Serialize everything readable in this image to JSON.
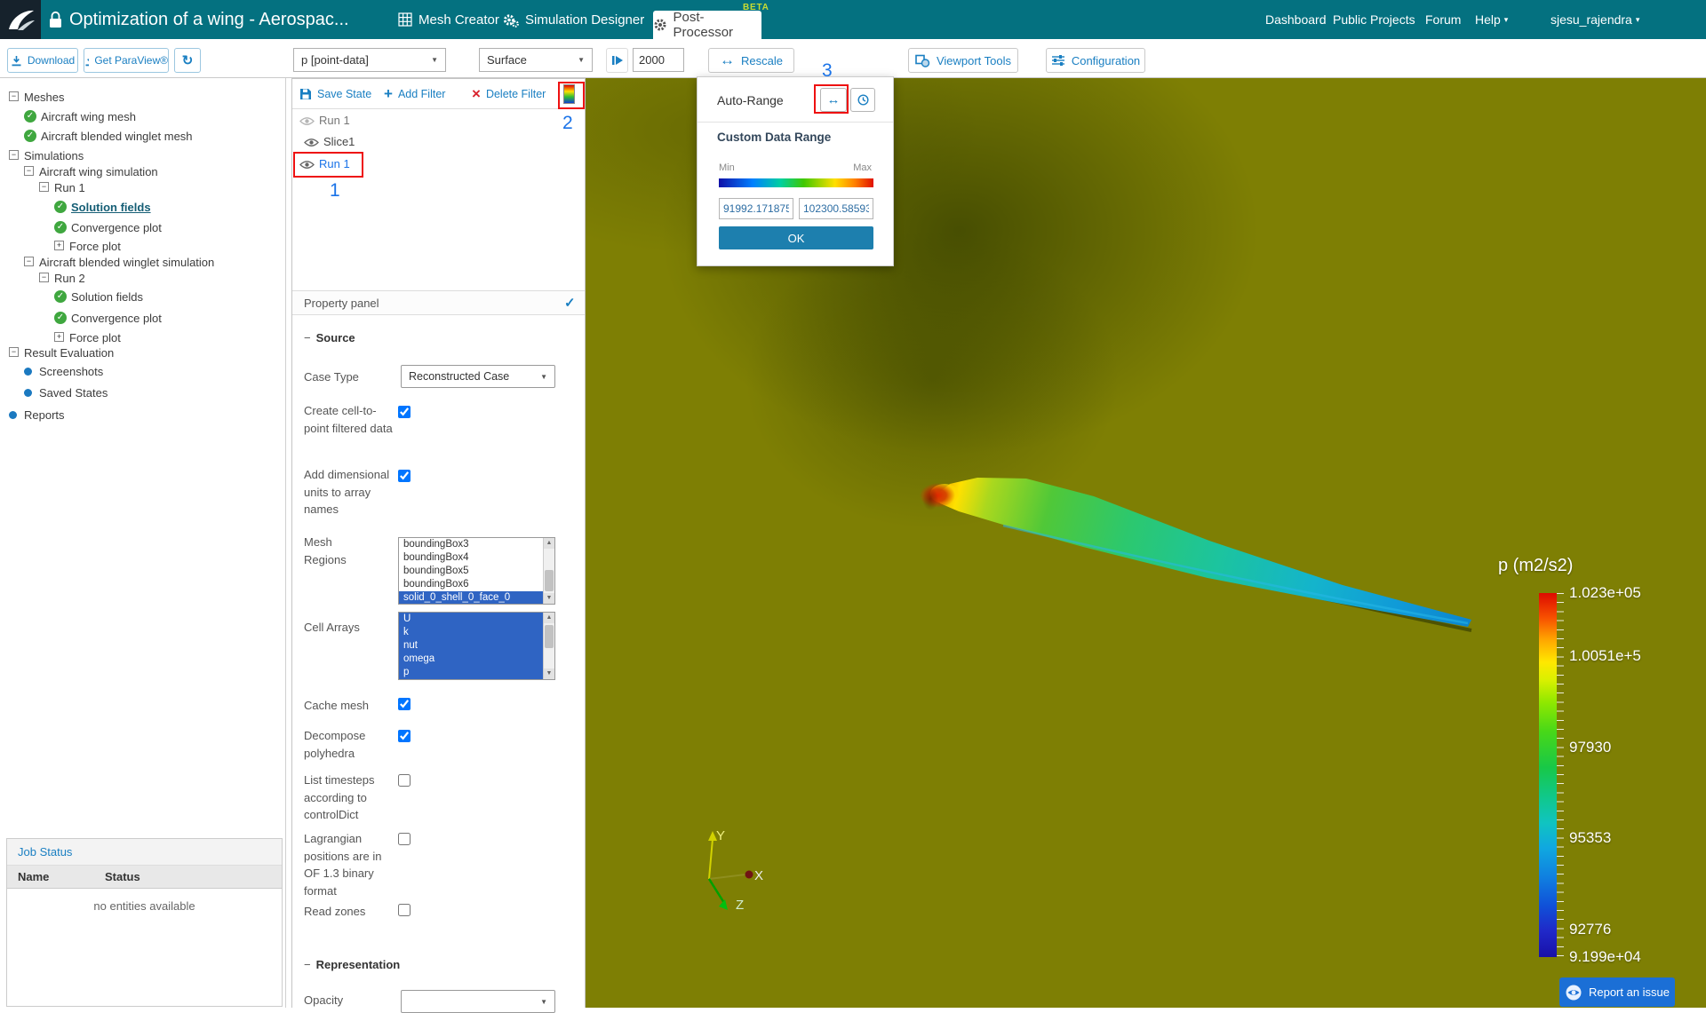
{
  "colors": {
    "header_teal": "#047180",
    "accent_blue": "#1a7fc2",
    "link_blue": "#1a73e8",
    "annotation_red": "#ee1111",
    "viewport_olive": "#7e7f04",
    "selection_blue": "#2f64c3",
    "ok_button_blue": "#1d7fae",
    "beta_yellow": "#c9dc32",
    "report_button_blue": "#1b6fd6"
  },
  "header": {
    "title": "Optimization of a wing - Aerospac...",
    "tabs": [
      {
        "label": "Mesh Creator"
      },
      {
        "label": "Simulation Designer"
      },
      {
        "label": "Post-Processor",
        "beta": "BETA"
      }
    ],
    "nav": [
      {
        "label": "Dashboard"
      },
      {
        "label": "Public Projects"
      },
      {
        "label": "Forum"
      },
      {
        "label": "Help",
        "caret": "▾"
      },
      {
        "label": "sjesu_rajendra",
        "caret": "▾"
      }
    ]
  },
  "sidebar": {
    "buttons": {
      "download": "Download",
      "get_paraview": "Get ParaView®"
    },
    "tree": [
      {
        "label": "Meshes"
      },
      {
        "label": "Aircraft wing mesh"
      },
      {
        "label": "Aircraft blended winglet mesh"
      },
      {
        "label": "Simulations"
      },
      {
        "label": "Aircraft wing simulation"
      },
      {
        "label": "Run 1"
      },
      {
        "label": "Solution fields"
      },
      {
        "label": "Convergence plot"
      },
      {
        "label": "Force plot"
      },
      {
        "label": "Aircraft blended winglet simulation"
      },
      {
        "label": "Run 2"
      },
      {
        "label": "Solution fields"
      },
      {
        "label": "Convergence plot"
      },
      {
        "label": "Force plot"
      },
      {
        "label": "Result Evaluation"
      },
      {
        "label": "Screenshots"
      },
      {
        "label": "Saved States"
      },
      {
        "label": "Reports"
      }
    ],
    "job_status": {
      "title": "Job Status",
      "col_name": "Name",
      "col_status": "Status",
      "empty": "no entities available"
    }
  },
  "toolbar": {
    "field_select": "p [point-data]",
    "representation_select": "Surface",
    "frame_value": "2000",
    "rescale_label": "Rescale",
    "viewport_tools_label": "Viewport Tools",
    "configuration_label": "Configuration"
  },
  "rescale_popup": {
    "auto_range_label": "Auto-Range",
    "custom_range_label": "Custom Data Range",
    "min_label": "Min",
    "max_label": "Max",
    "min_value": "91992.171875",
    "max_value": "102300.58593",
    "ok_label": "OK"
  },
  "filter_panel": {
    "save_state": "Save State",
    "add_filter": "Add Filter",
    "delete_filter": "Delete Filter",
    "pipeline": [
      {
        "label": "Run 1"
      },
      {
        "label": "Slice1"
      },
      {
        "label": "Run 1"
      }
    ],
    "property_panel_title": "Property panel",
    "source_section": "Source",
    "representation_section": "Representation",
    "fields": {
      "case_type_label": "Case Type",
      "case_type_value": "Reconstructed Case",
      "cell_to_point_label": "Create cell-to-point filtered data",
      "add_units_label": "Add dimensional units to array names",
      "mesh_regions_label": "Mesh Regions",
      "cell_arrays_label": "Cell Arrays",
      "cache_mesh_label": "Cache mesh",
      "decompose_label": "Decompose polyhedra",
      "list_timesteps_label": "List timesteps according to controlDict",
      "lagrangian_label": "Lagrangian positions are in OF 1.3 binary format",
      "read_zones_label": "Read zones",
      "opacity_label": "Opacity"
    },
    "checkboxes": {
      "cell_to_point": true,
      "add_units": true,
      "cache_mesh": true,
      "decompose": true,
      "list_timesteps": false,
      "lagrangian": false,
      "read_zones": false
    },
    "mesh_regions": [
      "boundingBox3",
      "boundingBox4",
      "boundingBox5",
      "boundingBox6",
      "solid_0_shell_0_face_0"
    ],
    "mesh_regions_selected": "solid_0_shell_0_face_0",
    "cell_arrays": [
      "U",
      "k",
      "nut",
      "omega",
      "p"
    ]
  },
  "viewport": {
    "legend": {
      "title": "p (m2/s2)",
      "labels": [
        "1.023e+05",
        "1.0051e+5",
        "97930",
        "95353",
        "92776",
        "9.199e+04"
      ]
    },
    "axes": {
      "x": "X",
      "y": "Y",
      "z": "Z"
    },
    "report_issue_label": "Report an issue"
  },
  "annotations": [
    {
      "number": "1"
    },
    {
      "number": "2"
    },
    {
      "number": "3"
    }
  ]
}
